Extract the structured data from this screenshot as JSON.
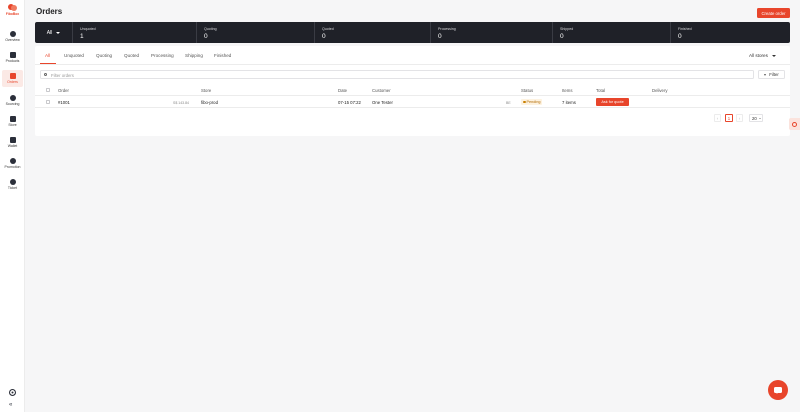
{
  "app": {
    "logo_text": "FiboBox"
  },
  "sidebar": {
    "items": [
      {
        "label": "Overview",
        "icon": "compass-icon"
      },
      {
        "label": "Products",
        "icon": "box-icon"
      },
      {
        "label": "Orders",
        "icon": "clipboard-icon",
        "active": true
      },
      {
        "label": "Sourcing",
        "icon": "globe-icon"
      },
      {
        "label": "Store",
        "icon": "store-icon"
      },
      {
        "label": "Wallet",
        "icon": "wallet-icon"
      },
      {
        "label": "Promotion",
        "icon": "users-icon"
      },
      {
        "label": "Ticket",
        "icon": "person-icon"
      }
    ],
    "footer_icons": [
      "gear-icon",
      "collapse-icon"
    ]
  },
  "header": {
    "title": "Orders",
    "create_button": "Create order"
  },
  "stats": {
    "all_label": "All",
    "items": [
      {
        "label": "Unquoted",
        "value": "1"
      },
      {
        "label": "Quoting",
        "value": "0"
      },
      {
        "label": "Quoted",
        "value": "0"
      },
      {
        "label": "Processing",
        "value": "0"
      },
      {
        "label": "Shipped",
        "value": "0"
      },
      {
        "label": "Finished",
        "value": "0"
      }
    ]
  },
  "tabs": [
    "All",
    "Unquoted",
    "Quoting",
    "Quoted",
    "Processing",
    "Shipping",
    "Finished"
  ],
  "active_tab": "All",
  "stores_select": "All stores",
  "search": {
    "placeholder": "Filter orders",
    "value": ""
  },
  "filter_button": "Filter",
  "table": {
    "columns": [
      "Order",
      "Store",
      "Date",
      "Customer",
      "Status",
      "Items",
      "Total",
      "Delivery"
    ],
    "rows": [
      {
        "order": "#1001",
        "order_amount": "S$ 143.84",
        "store": "fibo-prod",
        "date": "07-15 07:22",
        "customer": "One Tester",
        "customer_country": "BE",
        "status": "Pending",
        "items": "7 items",
        "total_action": "Ask for quote",
        "delivery": ""
      }
    ]
  },
  "pagination": {
    "current_page": "1",
    "page_size": "20",
    "prev": "‹",
    "next": "›"
  },
  "colors": {
    "accent": "#e8452b",
    "dark_bar": "#1f2128",
    "pending_bg": "#fdf2e0"
  }
}
